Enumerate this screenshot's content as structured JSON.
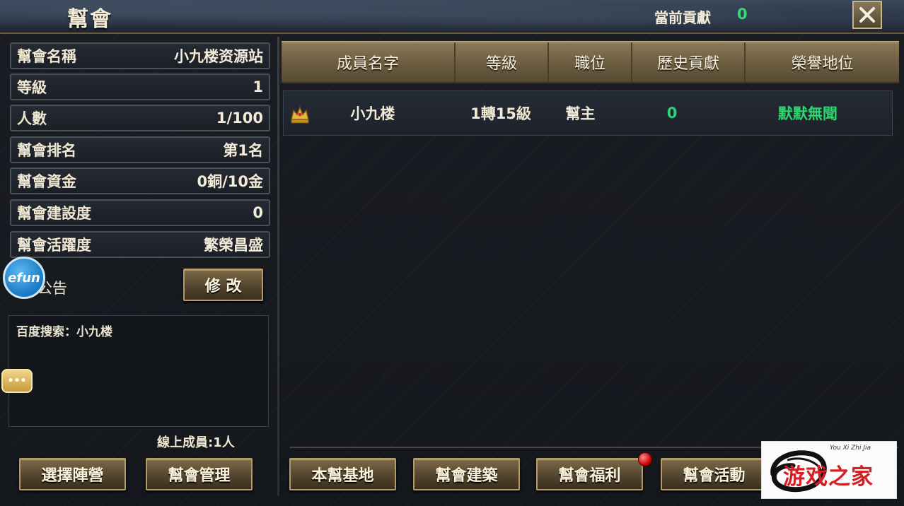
{
  "header": {
    "title": "幫會",
    "contribution_label": "當前貢獻",
    "contribution_value": "0",
    "close_icon": "close-icon"
  },
  "guild_info": [
    {
      "label": "幫會名稱",
      "value": "小九楼资源站"
    },
    {
      "label": "等級",
      "value": "1"
    },
    {
      "label": "人數",
      "value": "1/100"
    },
    {
      "label": "幫會排名",
      "value": "第1名"
    },
    {
      "label": "幫會資金",
      "value": "0銅/10金"
    },
    {
      "label": "幫會建設度",
      "value": "0"
    },
    {
      "label": "幫會活躍度",
      "value": "繁榮昌盛"
    }
  ],
  "notice": {
    "label": "會公告",
    "edit_button": "修 改",
    "text": "百度搜索：小九楼"
  },
  "efun_badge": "efun",
  "chat_bubble": "•••",
  "online_members": "線上成員:1人",
  "left_buttons": {
    "choose_camp": "選擇陣營",
    "guild_manage": "幫會管理"
  },
  "members_table": {
    "columns": [
      "成員名字",
      "等級",
      "職位",
      "歷史貢獻",
      "榮譽地位"
    ],
    "rows": [
      {
        "name": "小九楼",
        "level": "1轉15級",
        "position": "幫主",
        "history_contribution": "0",
        "honor": "默默無聞"
      }
    ]
  },
  "bottom_buttons": {
    "base": "本幫基地",
    "buildings": "幫會建築",
    "welfare": "幫會福利",
    "activities": "幫會活動"
  },
  "watermark_logo": {
    "small_text": "You Xi Zhi Jia",
    "big_text": "游戏之家"
  },
  "colors": {
    "accent_green": "#2fd27a",
    "button_gold": "#7d6a48",
    "panel_dark": "#1b1f26"
  }
}
